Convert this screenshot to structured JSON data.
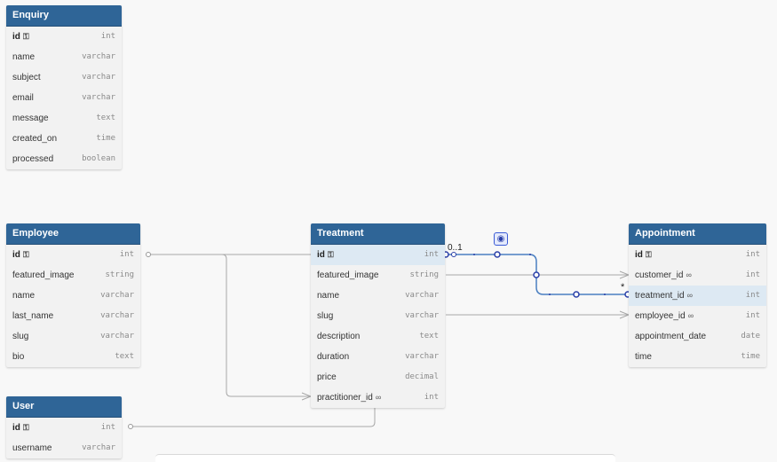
{
  "tables": {
    "enquiry": {
      "title": "Enquiry",
      "columns": [
        {
          "name": "id",
          "type": "int",
          "pk": true
        },
        {
          "name": "name",
          "type": "varchar"
        },
        {
          "name": "subject",
          "type": "varchar"
        },
        {
          "name": "email",
          "type": "varchar"
        },
        {
          "name": "message",
          "type": "text"
        },
        {
          "name": "created_on",
          "type": "time"
        },
        {
          "name": "processed",
          "type": "boolean"
        }
      ]
    },
    "employee": {
      "title": "Employee",
      "columns": [
        {
          "name": "id",
          "type": "int",
          "pk": true
        },
        {
          "name": "featured_image",
          "type": "string"
        },
        {
          "name": "name",
          "type": "varchar"
        },
        {
          "name": "last_name",
          "type": "varchar"
        },
        {
          "name": "slug",
          "type": "varchar"
        },
        {
          "name": "bio",
          "type": "text"
        }
      ]
    },
    "treatment": {
      "title": "Treatment",
      "columns": [
        {
          "name": "id",
          "type": "int",
          "pk": true,
          "highlight": true
        },
        {
          "name": "featured_image",
          "type": "string"
        },
        {
          "name": "name",
          "type": "varchar"
        },
        {
          "name": "slug",
          "type": "varchar"
        },
        {
          "name": "description",
          "type": "text"
        },
        {
          "name": "duration",
          "type": "varchar"
        },
        {
          "name": "price",
          "type": "decimal"
        },
        {
          "name": "practitioner_id",
          "type": "int",
          "fk": true
        }
      ]
    },
    "appointment": {
      "title": "Appointment",
      "columns": [
        {
          "name": "id",
          "type": "int",
          "pk": true
        },
        {
          "name": "customer_id",
          "type": "int",
          "fk": true
        },
        {
          "name": "treatment_id",
          "type": "int",
          "fk": true,
          "highlight": true
        },
        {
          "name": "employee_id",
          "type": "int",
          "fk": true
        },
        {
          "name": "appointment_date",
          "type": "date"
        },
        {
          "name": "time",
          "type": "time"
        }
      ]
    },
    "user": {
      "title": "User",
      "columns": [
        {
          "name": "id",
          "type": "int",
          "pk": true
        },
        {
          "name": "username",
          "type": "varchar"
        }
      ]
    }
  },
  "relations": {
    "treatment_appointment": {
      "from_label": "0..1",
      "to_label": "*"
    }
  },
  "icons": {
    "primary_key": "key-icon",
    "foreign_key": "link-icon",
    "relation_color": "palette-icon"
  },
  "colors": {
    "header": "#2f6597",
    "relation_highlight": "#4a7fc1",
    "relation": "#a8a8a8",
    "row_highlight": "#dde9f3"
  }
}
